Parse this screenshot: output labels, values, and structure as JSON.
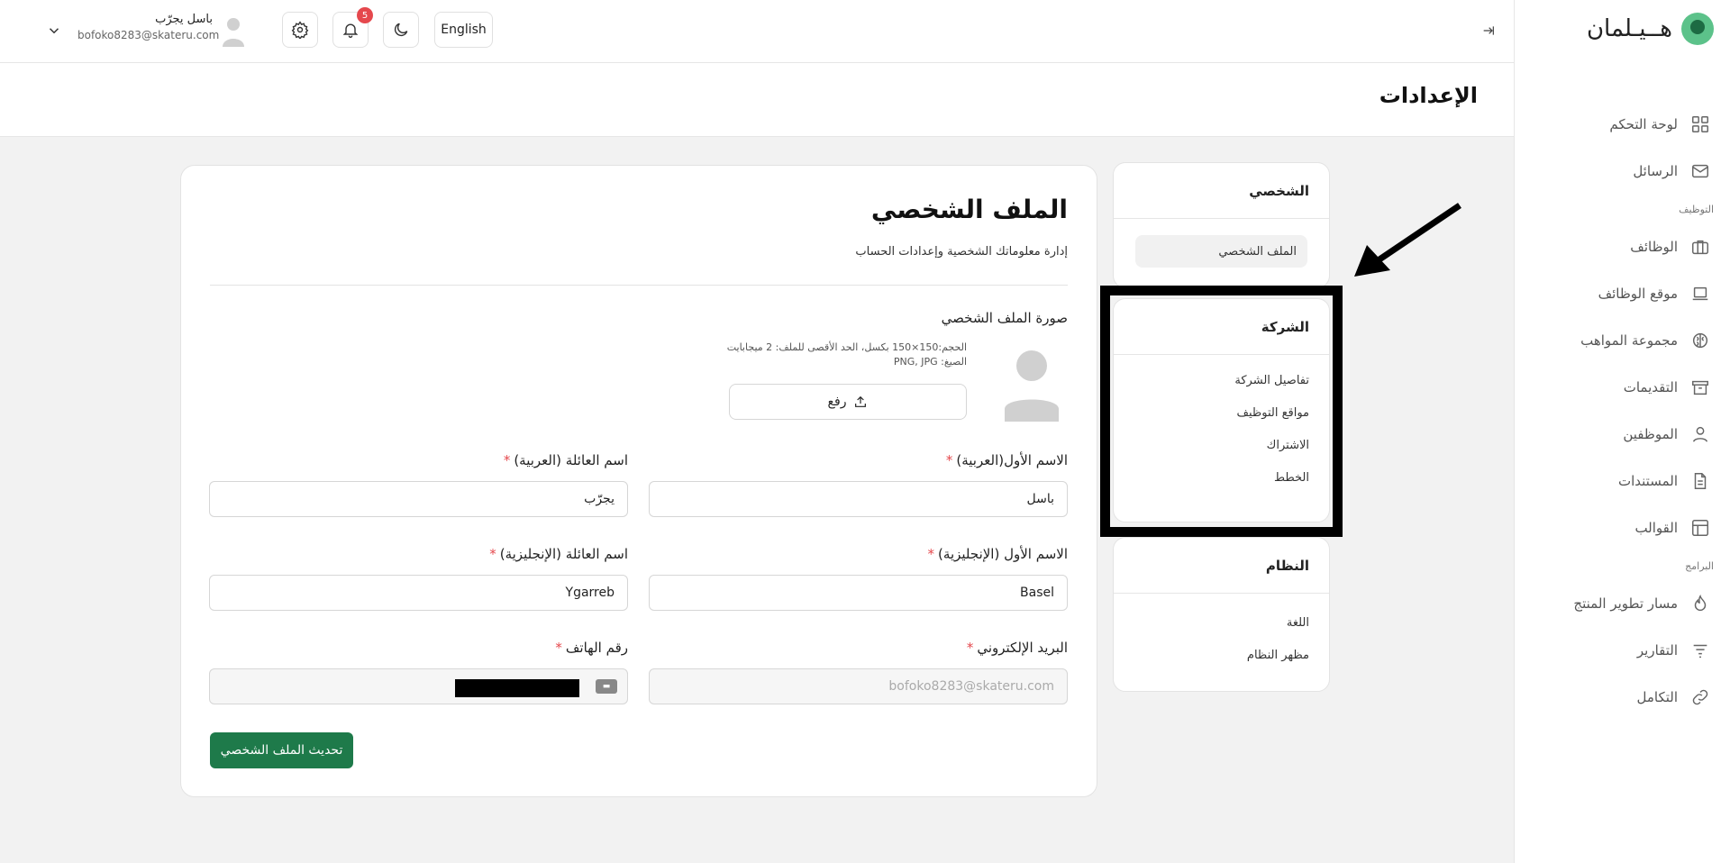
{
  "brand": {
    "name": "هــيـلمان",
    "color": "#5cc28a"
  },
  "sidebar": {
    "items": [
      {
        "label": "لوحة التحكم",
        "icon": "grid-icon"
      },
      {
        "label": "الرسائل",
        "icon": "mail-icon"
      }
    ],
    "section_hiring": "التوظيف",
    "hiring_items": [
      {
        "label": "الوظائف",
        "icon": "briefcase-icon"
      },
      {
        "label": "موقع الوظائف",
        "icon": "laptop-icon"
      },
      {
        "label": "مجموعة المواهب",
        "icon": "brain-icon"
      },
      {
        "label": "التقديمات",
        "icon": "inbox-icon"
      },
      {
        "label": "الموظفين",
        "icon": "user-icon"
      },
      {
        "label": "المستندات",
        "icon": "document-icon"
      },
      {
        "label": "القوالب",
        "icon": "layout-icon"
      }
    ],
    "section_programs": "البرامج",
    "program_items": [
      {
        "label": "مسار تطوير المنتج",
        "icon": "flame-icon"
      },
      {
        "label": "التقارير",
        "icon": "filter-lines-icon"
      },
      {
        "label": "التكامل",
        "icon": "link-icon"
      }
    ]
  },
  "topbar": {
    "language": "English",
    "notifications_count": "5",
    "user_name": "باسل يجرّب",
    "user_email": "bofoko8283@skateru.com"
  },
  "page": {
    "title": "الإعدادات"
  },
  "settings_menu": {
    "personal": {
      "title": "الشخصي",
      "items": [
        "الملف الشخصي"
      ]
    },
    "company": {
      "title": "الشركة",
      "items": [
        "تفاصيل الشركة",
        "مواقع التوظيف",
        "الاشتراك",
        "الخطط"
      ]
    },
    "system": {
      "title": "النظام",
      "items": [
        "اللغة",
        "مظهر النظام"
      ]
    }
  },
  "profile": {
    "title": "الملف الشخصي",
    "subtitle": "إدارة معلوماتك الشخصية وإعدادات الحساب",
    "photo_label": "صورة الملف الشخصي",
    "photo_hint_size": "الحجم:150×150 بكسل، الحد الأقصى للملف: 2 ميجابايت",
    "photo_hint_formats": "الصيغ: PNG, JPG",
    "upload_label": "رفع",
    "first_name_ar_label": "الاسم الأول(العربية)",
    "first_name_ar": "باسل",
    "last_name_ar_label": "اسم العائلة (العربية)",
    "last_name_ar": "يجرّب",
    "first_name_en_label": "الاسم الأول (الإنجليزية)",
    "first_name_en": "Basel",
    "last_name_en_label": "اسم العائلة (الإنجليزية)",
    "last_name_en": "Ygarreb",
    "email_label": "البريد الإلكتروني",
    "email": "bofoko8283@skateru.com",
    "phone_label": "رقم الهاتف",
    "required_mark": "*",
    "submit_label": "تحديث الملف الشخصي"
  },
  "colors": {
    "primary": "#1e7a4a",
    "required": "#e5484d",
    "badge": "#e5484d"
  }
}
